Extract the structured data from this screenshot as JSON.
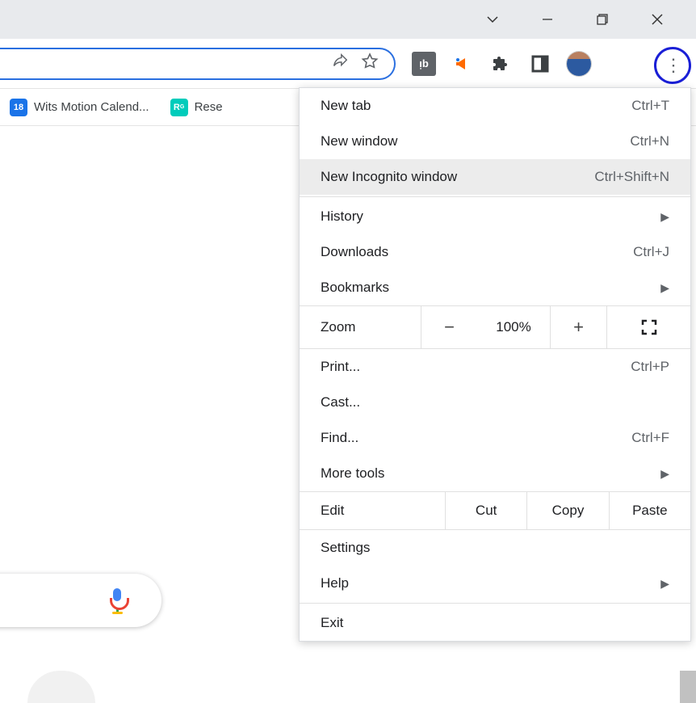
{
  "bookmarks": [
    {
      "icon_text": "18",
      "label": "Wits Motion Calend..."
    },
    {
      "icon_text": "R",
      "label": "Rese"
    }
  ],
  "menu": {
    "new_tab": {
      "label": "New tab",
      "shortcut": "Ctrl+T"
    },
    "new_window": {
      "label": "New window",
      "shortcut": "Ctrl+N"
    },
    "incognito": {
      "label": "New Incognito window",
      "shortcut": "Ctrl+Shift+N"
    },
    "history": {
      "label": "History"
    },
    "downloads": {
      "label": "Downloads",
      "shortcut": "Ctrl+J"
    },
    "bookmarks": {
      "label": "Bookmarks"
    },
    "zoom_label": "Zoom",
    "zoom_value": "100%",
    "print": {
      "label": "Print...",
      "shortcut": "Ctrl+P"
    },
    "cast": {
      "label": "Cast..."
    },
    "find": {
      "label": "Find...",
      "shortcut": "Ctrl+F"
    },
    "more_tools": {
      "label": "More tools"
    },
    "edit_label": "Edit",
    "cut": "Cut",
    "copy": "Copy",
    "paste": "Paste",
    "settings": {
      "label": "Settings"
    },
    "help": {
      "label": "Help"
    },
    "exit": {
      "label": "Exit"
    }
  }
}
